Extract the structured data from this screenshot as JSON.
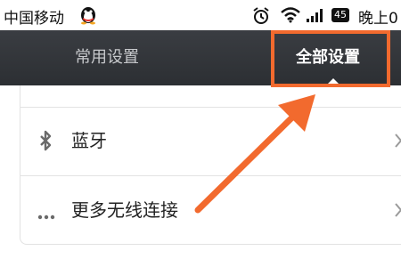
{
  "status_bar": {
    "carrier": "中国移动",
    "battery": "45",
    "clock": "晚上0"
  },
  "tabs": {
    "common_label": "常用设置",
    "all_label": "全部设置"
  },
  "settings": {
    "items": [
      {
        "label": "蓝牙",
        "icon": "bluetooth-icon"
      },
      {
        "label": "更多无线连接",
        "icon": "more-dots-icon"
      }
    ]
  },
  "annotation": {
    "color": "#f26a2e"
  }
}
